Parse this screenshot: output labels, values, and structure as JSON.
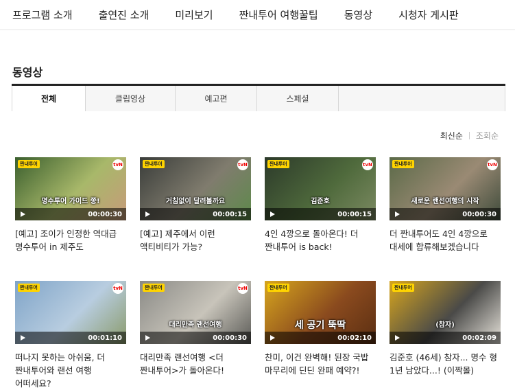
{
  "nav": [
    "프로그램 소개",
    "출연진 소개",
    "미리보기",
    "짠내투어 여행꿀팁",
    "동영상",
    "시청자 게시판"
  ],
  "section_title": "동영상",
  "tabs": [
    "전체",
    "클립영상",
    "예고편",
    "스페셜"
  ],
  "sort": {
    "latest": "최신순",
    "views": "조회순"
  },
  "videos": [
    {
      "title": "[예고] 조이가 인정한 역대급 명수투어 in 제주도",
      "duration": "00:00:30",
      "caption": "명수투어 가이드 쫑!",
      "badge": "짠내투어",
      "logo": "tvN",
      "colors": [
        "#3b5f2e",
        "#a8b86a",
        "#c79a7a"
      ]
    },
    {
      "title": "[예고] 제주에서 이런 액티비티가 가능?",
      "duration": "00:00:15",
      "caption": "거침없이 달려볼까요",
      "badge": "짠내투어",
      "logo": "tvN",
      "colors": [
        "#3a3d3a",
        "#807c6e",
        "#5d8a4a"
      ]
    },
    {
      "title": "4인 4깡으로 돌아온다! 더 짠내투어 is back!",
      "duration": "00:00:15",
      "caption": "김준호",
      "badge": "짠내투어",
      "logo": "tvN",
      "colors": [
        "#2c3a2a",
        "#4f6a3c",
        "#7c8a62"
      ]
    },
    {
      "title": "더 짠내투어도 4인 4깡으로 대세에 합류해보겠습니다",
      "duration": "00:00:30",
      "caption": "새로운 랜선여행의 시작",
      "badge": "짠내투어",
      "logo": "tvN",
      "colors": [
        "#5b6a48",
        "#9a8a74",
        "#3d4a3a"
      ]
    },
    {
      "title": "떠나지 못하는 아쉬움, 더 짠내투어와 랜선 여행 어떠세요?",
      "duration": "00:01:10",
      "caption": "",
      "badge": "짠내투어",
      "logo": "tvN",
      "colors": [
        "#7fa4c8",
        "#b8cde0",
        "#8a9a6a"
      ]
    },
    {
      "title": "대리만족 랜선여행 <더 짠내투어>가 돌아온다!",
      "duration": "00:00:30",
      "caption": "대리만족 랜선여행",
      "badge": "짠내투어",
      "logo": "tvN",
      "colors": [
        "#8a8a86",
        "#c8c4ba",
        "#5a5a56"
      ]
    },
    {
      "title": "찬미, 이건 완벽해! 된장 국밥 마무리에 딘딘 완패 예약?!",
      "duration": "00:02:10",
      "caption": "세 공기 뚝딱",
      "badge": "짠내투어",
      "logo": "",
      "colors": [
        "#d7a61e",
        "#8a4a1e",
        "#5a2e12"
      ]
    },
    {
      "title": "김준호 (46세) 참자... 명수 형 1년 남았다...! (이짝몰)",
      "duration": "00:02:09",
      "caption": "(참자)",
      "badge": "짠내투어",
      "logo": "",
      "colors": [
        "#d7a61e",
        "#4a4a48",
        "#e8e4dc"
      ]
    }
  ]
}
